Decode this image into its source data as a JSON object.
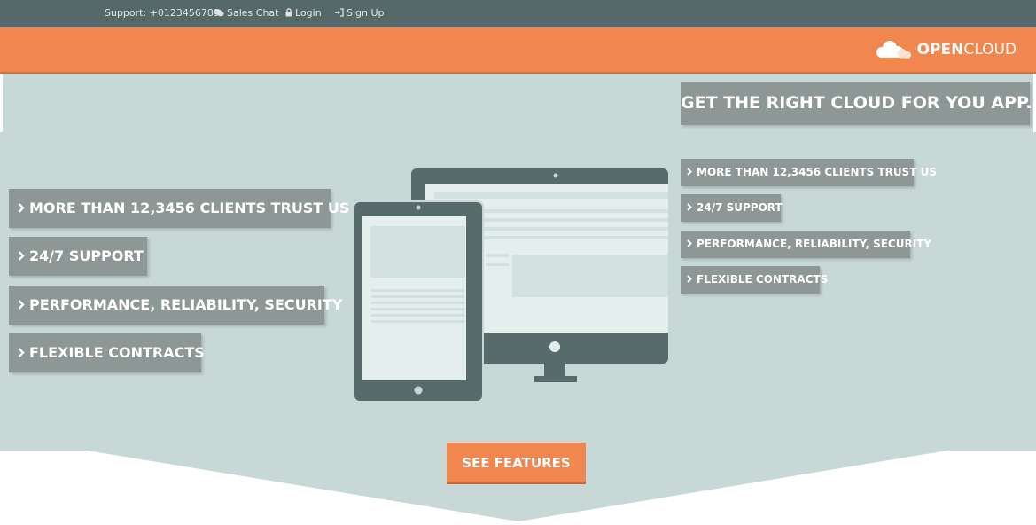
{
  "topbar": {
    "support": "Support: +0123456789",
    "sales_chat": "Sales Chat",
    "login": "Login",
    "signup": "Sign Up"
  },
  "logo": {
    "bold": "OPEN",
    "light": "CLOUD"
  },
  "hero": {
    "tagline": "GET THE RIGHT CLOUD FOR YOU APP.",
    "features_left": [
      "MORE THAN 12,3456 CLIENTS TRUST US",
      "24/7 SUPPORT",
      "PERFORMANCE, RELIABILITY, SECURITY",
      "FLEXIBLE CONTRACTS"
    ],
    "features_right": [
      "MORE THAN 12,3456 CLIENTS TRUST US",
      "24/7 SUPPORT",
      "PERFORMANCE, RELIABILITY, SECURITY",
      "FLEXIBLE CONTRACTS"
    ],
    "cta": "SEE FEATURES"
  },
  "colors": {
    "topbar": "#56696a",
    "accent": "#f1874e",
    "hero_bg": "#c8d8d6",
    "feature_box": "#8d9795",
    "device_frame": "#586b6b"
  }
}
